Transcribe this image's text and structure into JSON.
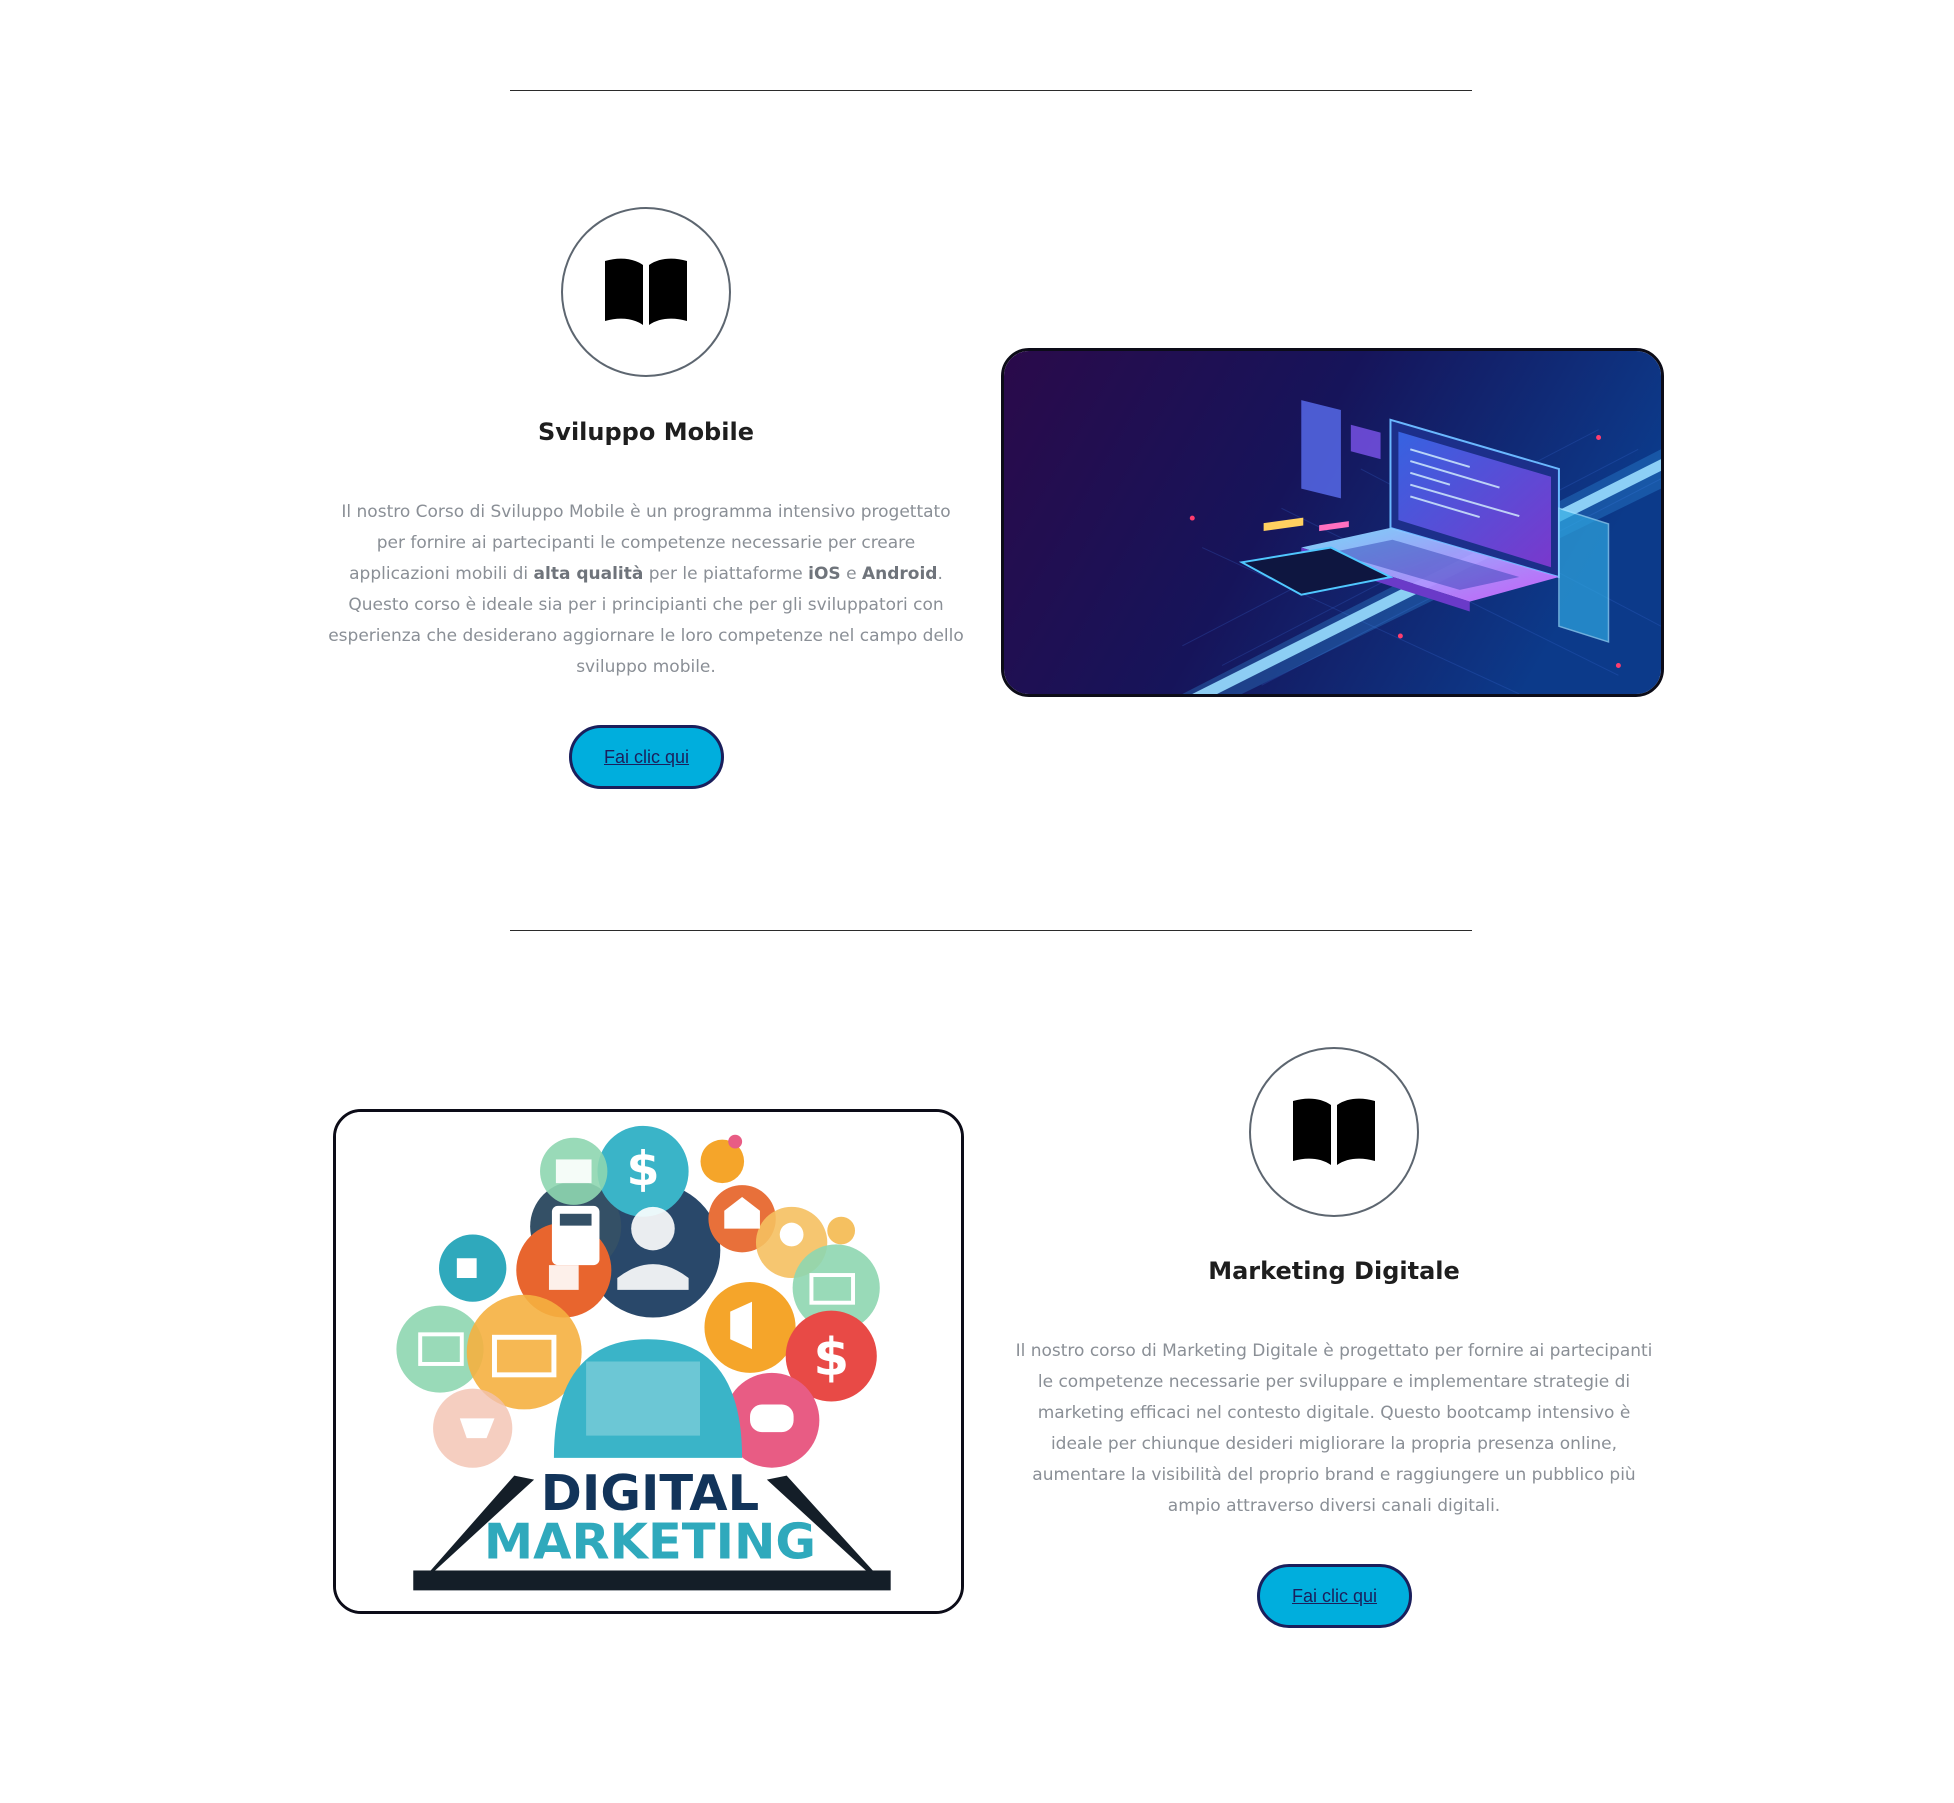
{
  "sections": [
    {
      "icon": "open-book-icon",
      "title": "Sviluppo Mobile",
      "description": {
        "part1": "Il nostro Corso di Sviluppo Mobile è un programma intensivo progettato per fornire ai partecipanti le competenze necessarie per creare applicazioni mobili di ",
        "bold1": "alta qualità",
        "part2": " per le piattaforme ",
        "bold2": "iOS",
        "part3": " e ",
        "bold3": "Android",
        "part4": ". Questo corso è ideale sia per i principianti che per gli sviluppatori con esperienza che desiderano aggiornare le loro competenze nel campo dello sviluppo mobile."
      },
      "button_label": "Fai clic qui",
      "image": "isometric-laptop-mobile-app-illustration"
    },
    {
      "icon": "open-book-icon",
      "title": "Marketing Digitale",
      "description": "Il nostro corso di Marketing Digitale è progettato per fornire ai partecipanti le competenze necessarie per sviluppare e implementare strategie di marketing efficaci nel contesto digitale. Questo bootcamp intensivo è ideale per chiunque desideri migliorare la propria presenza online, aumentare la visibilità del proprio brand e raggiungere un pubblico più ampio attraverso diversi canali digitali.",
      "button_label": "Fai clic qui",
      "image": "digital-marketing-illustration",
      "image_text": {
        "line1": "DIGITAL",
        "line2": "MARKETING"
      }
    }
  ],
  "colors": {
    "button_bg": "#00aedd",
    "button_border": "#1a1f5c",
    "text_muted": "#8a8f96",
    "title": "#1e1e1e",
    "divider": "#2b2b2b"
  }
}
